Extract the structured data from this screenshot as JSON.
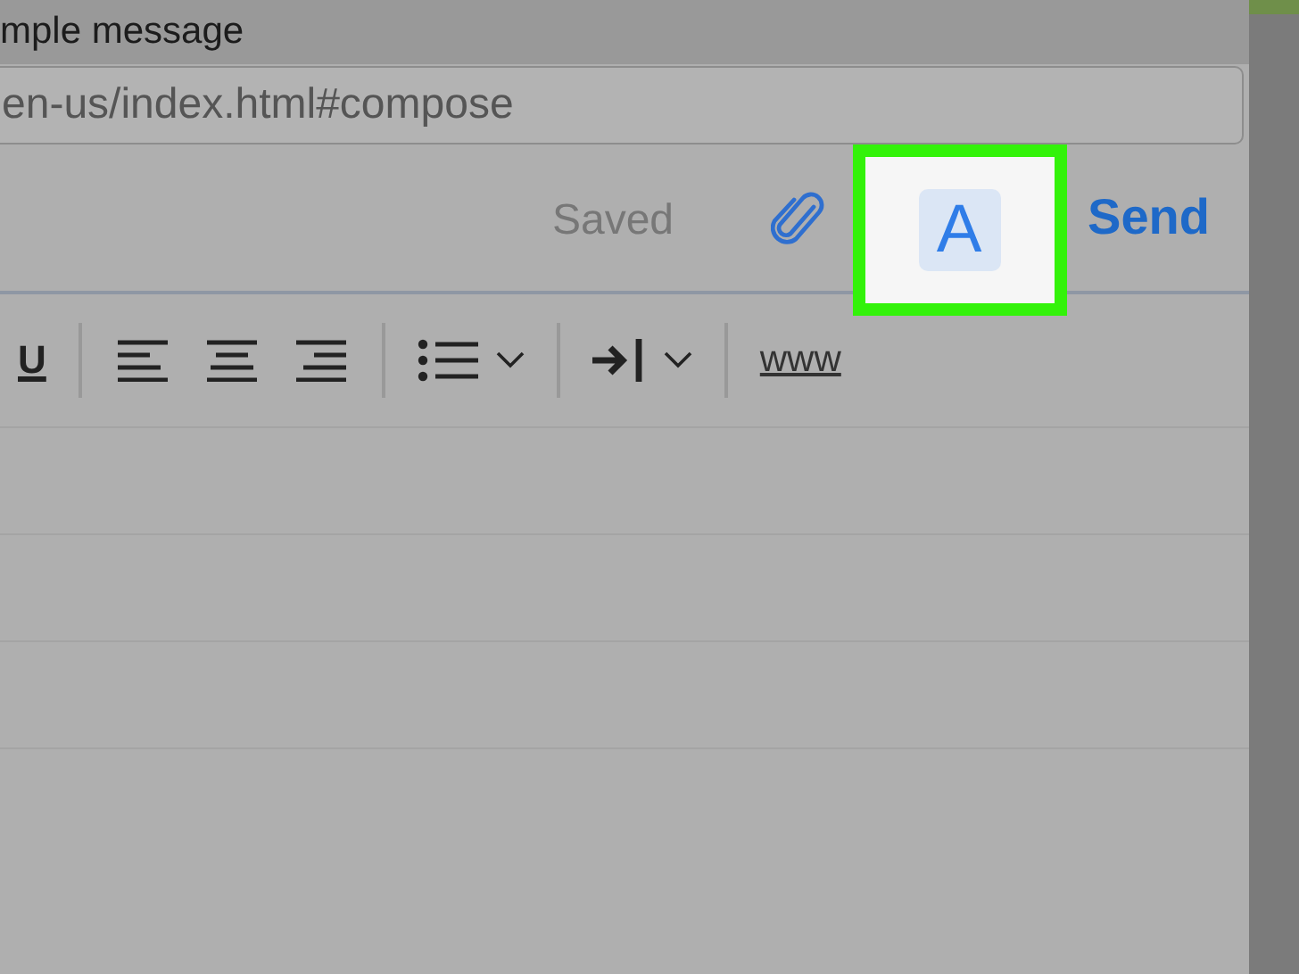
{
  "window": {
    "title": "mple message"
  },
  "address_bar": {
    "url": "en-us/index.html#compose"
  },
  "compose_toolbar": {
    "status": "Saved",
    "format_button": {
      "label": "A",
      "selected": true,
      "highlighted": true
    },
    "send": "Send"
  },
  "format_bar": [
    {
      "kind": "underline",
      "label": "U"
    },
    {
      "kind": "separator"
    },
    {
      "kind": "align-left"
    },
    {
      "kind": "align-center"
    },
    {
      "kind": "align-right"
    },
    {
      "kind": "separator"
    },
    {
      "kind": "bullet-list",
      "dropdown": true
    },
    {
      "kind": "separator"
    },
    {
      "kind": "indent",
      "dropdown": true
    },
    {
      "kind": "separator"
    },
    {
      "kind": "link",
      "label": "www"
    }
  ]
}
